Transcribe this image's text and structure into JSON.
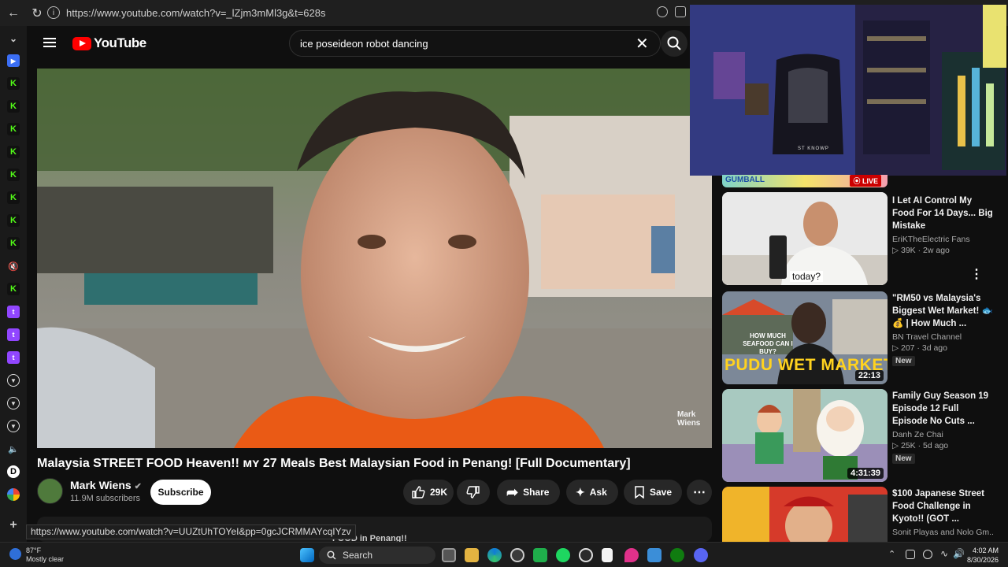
{
  "browser": {
    "url": "https://www.youtube.com/watch?v=_lZjm3mMl3g&t=628s"
  },
  "youtube": {
    "logo_text": "YouTube",
    "search_value": "ice poseideon robot dancing"
  },
  "video": {
    "watermark": "Mark Wiens",
    "title": "Malaysia STREET FOOD Heaven!! ᴍʏ 27 Meals Best Malaysian Food in Penang! [Full Documentary]",
    "channel_name": "Mark Wiens",
    "subscribers": "11.9M subscribers",
    "subscribe_label": "Subscribe",
    "likes": "29K",
    "share_label": "Share",
    "ask_label": "Ask",
    "save_label": "Save"
  },
  "hover_url": "https://www.youtube.com/watch?v=UUZtUhTOYeI&pp=0gcJCRMMAYcqIYzv",
  "below_text": "FOOD in Penang!!",
  "webcam": {
    "chair_text": "ST KNOWP"
  },
  "live_badge": "LIVE",
  "gumball_text": "GUMBALL",
  "recommendations": [
    {
      "title": "I Let AI Control My Food For 14 Days... Big Mistake",
      "channel": "EriKTheElectric Fans",
      "meta": "39K · 2w ago",
      "duration": "",
      "new": "",
      "thumb_caption": "today?"
    },
    {
      "title": "\"RM50 vs Malaysia's Biggest Wet Market! 🐟💰 | How Much ...",
      "channel": "BN Travel Channel",
      "meta": "207 · 3d ago",
      "duration": "22:13",
      "new": "New",
      "thumb_caption": "PUDU WET MARKET",
      "thumb_sub": "HOW MUCH SEAFOOD CAN I BUY?"
    },
    {
      "title": "Family Guy Season 19 Episode 12 Full Episode No Cuts ...",
      "channel": "Danh Ze Chai",
      "meta": "25K · 5d ago",
      "duration": "4:31:39",
      "new": "New"
    },
    {
      "title": "$100 Japanese Street Food Challenge in Kyoto!! (GOT ...",
      "channel": "Sonit Playas and Nolo Gm...",
      "meta": "",
      "duration": ""
    }
  ],
  "taskbar": {
    "temp": "87°F",
    "weather": "Mostly clear",
    "search_label": "Search",
    "time": "4:02 AM",
    "date": "8/30/2026"
  }
}
